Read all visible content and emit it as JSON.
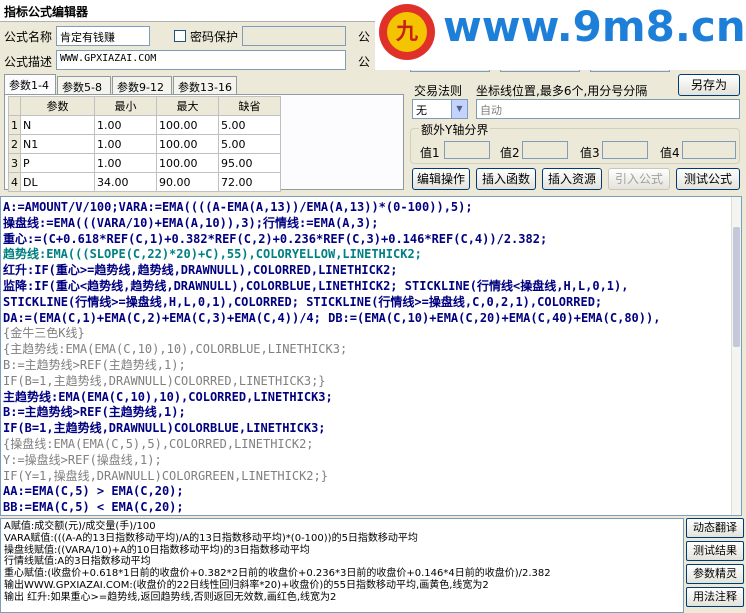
{
  "window": {
    "title": "指标公式编辑器"
  },
  "watermark": {
    "logo_text": "九",
    "site": "www.9m8.cn"
  },
  "form": {
    "name_label": "公式名称",
    "name_value": "肯定有钱赚",
    "password_label": "密码保护",
    "desc_label": "公式描述",
    "desc_value": "WWW.GPXIAZAI.COM",
    "right_label_1": "公",
    "right_label_2": "公"
  },
  "params": {
    "tabs": [
      "参数1-4",
      "参数5-8",
      "参数9-12",
      "参数13-16"
    ],
    "headers": [
      "参数",
      "最小",
      "最大",
      "缺省"
    ],
    "rows": [
      {
        "idx": "1",
        "name": "N",
        "min": "1.00",
        "max": "100.00",
        "def": "5.00"
      },
      {
        "idx": "2",
        "name": "N1",
        "min": "1.00",
        "max": "100.00",
        "def": "5.00"
      },
      {
        "idx": "3",
        "name": "P",
        "min": "1.00",
        "max": "100.00",
        "def": "95.00"
      },
      {
        "idx": "4",
        "name": "DL",
        "min": "34.00",
        "max": "90.00",
        "def": "72.00"
      }
    ]
  },
  "rule": {
    "label": "交易法则",
    "select_value": "无",
    "hint": "坐标线位置,最多6个,用分号分隔",
    "auto_value": "自动",
    "save_as": "另存为"
  },
  "extra_y": {
    "label": "额外Y轴分界",
    "v1": "值1",
    "v2": "值2",
    "v3": "值3",
    "v4": "值4"
  },
  "buttons": {
    "edit": "编辑操作",
    "insert_func": "插入函数",
    "insert_res": "插入资源",
    "import": "引入公式",
    "test": "测试公式"
  },
  "code_lines": [
    {
      "text": "A:=AMOUNT/V/100;VARA:=EMA((((A-EMA(A,13))/EMA(A,13))*(0-100)),5);",
      "color": "#000080"
    },
    {
      "text": "操盘线:=EMA(((VARA/10)+EMA(A,10)),3);行情线:=EMA(A,3);",
      "color": "#000080"
    },
    {
      "text": "重心:=(C+0.618*REF(C,1)+0.382*REF(C,2)+0.236*REF(C,3)+0.146*REF(C,4))/2.382;",
      "color": "#000080"
    },
    {
      "text": "趋势线:EMA(((SLOPE(C,22)*20)+C),55),COLORYELLOW,LINETHICK2;",
      "color": "#008080"
    },
    {
      "text": "红升:IF(重心>=趋势线,趋势线,DRAWNULL),COLORRED,LINETHICK2;",
      "color": "#000080"
    },
    {
      "text": "监降:IF(重心<趋势线,趋势线,DRAWNULL),COLORBLUE,LINETHICK2; STICKLINE(行情线<操盘线,H,L,0,1),",
      "color": "#000080"
    },
    {
      "text": "STICKLINE(行情线>=操盘线,H,L,0,1),COLORRED; STICKLINE(行情线>=操盘线,C,0,2,1),COLORRED;",
      "color": "#000080"
    },
    {
      "text": "DA:=(EMA(C,1)+EMA(C,2)+EMA(C,3)+EMA(C,4))/4; DB:=(EMA(C,10)+EMA(C,20)+EMA(C,40)+EMA(C,80)),",
      "color": "#000080"
    },
    {
      "text": "{金牛三色K线}",
      "color": "#808080"
    },
    {
      "text": "{主趋势线:EMA(EMA(C,10),10),COLORBLUE,LINETHICK3;",
      "color": "#808080"
    },
    {
      "text": "B:=主趋势线>REF(主趋势线,1);",
      "color": "#808080"
    },
    {
      "text": "IF(B=1,主趋势线,DRAWNULL)COLORRED,LINETHICK3;}",
      "color": "#808080"
    },
    {
      "text": "主趋势线:EMA(EMA(C,10),10),COLORRED,LINETHICK3;",
      "color": "#000080"
    },
    {
      "text": "B:=主趋势线>REF(主趋势线,1);",
      "color": "#000080"
    },
    {
      "text": "IF(B=1,主趋势线,DRAWNULL)COLORBLUE,LINETHICK3;",
      "color": "#000080"
    },
    {
      "text": "{操盘线:EMA(EMA(C,5),5),COLORRED,LINETHICK2;",
      "color": "#808080"
    },
    {
      "text": "Y:=操盘线>REF(操盘线,1);",
      "color": "#808080"
    },
    {
      "text": "IF(Y=1,操盘线,DRAWNULL)COLORGREEN,LINETHICK2;}",
      "color": "#808080"
    },
    {
      "text": "AA:=EMA(C,5) > EMA(C,20);",
      "color": "#000080"
    },
    {
      "text": "BB:=EMA(C,5) < EMA(C,20);",
      "color": "#000080"
    }
  ],
  "output_lines": [
    "A赋值:成交额(元)/成交量(手)/100",
    "VARA赋值:(((A-A的13日指数移动平均)/A的13日指数移动平均)*(0-100))的5日指数移动平均",
    "操盘线赋值:((VARA/10)+A的10日指数移动平均)的3日指数移动平均",
    "行情线赋值:A的3日指数移动平均",
    "重心赋值:(收盘价+0.618*1日前的收盘价+0.382*2日前的收盘价+0.236*3日前的收盘价+0.146*4日前的收盘价)/2.382",
    "输出WWW.GPXIAZAI.COM:(收盘价的22日线性回归斜率*20)+收盘价)的55日指数移动平均,画黄色,线宽为2",
    "输出 红升:如果重心>=趋势线,返回趋势线,否则返回无效数,画红色,线宽为2"
  ],
  "side_buttons": [
    "动态翻译",
    "测试结果",
    "参数精灵",
    "用法注释"
  ]
}
